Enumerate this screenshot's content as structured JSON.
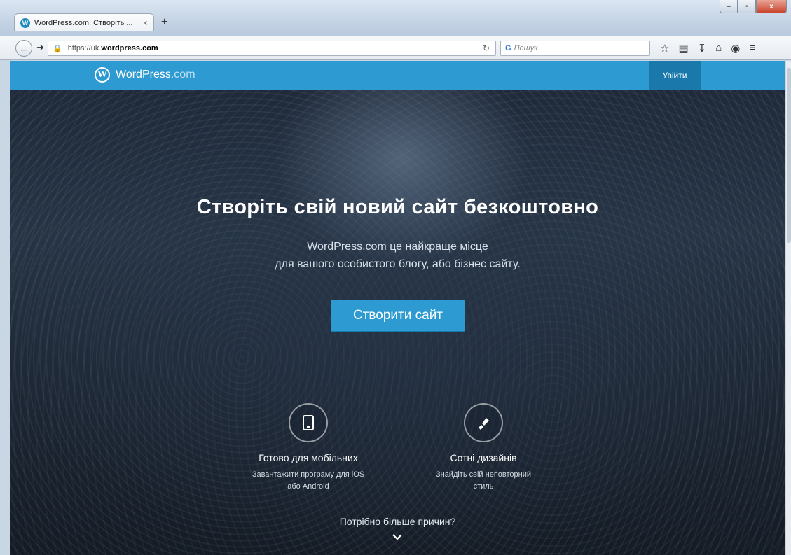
{
  "browser": {
    "tab_title": "WordPress.com: Створіть ...",
    "tab_close": "×",
    "new_tab": "+",
    "url_prefix": "https://uk.",
    "url_domain": "wordpress.com",
    "search_placeholder": "Пошук",
    "window_controls": [
      "–",
      "▫",
      "x"
    ]
  },
  "masterbar": {
    "brand_main": "WordPress",
    "brand_suffix": ".com",
    "login_label": "Увійти",
    "colors": {
      "bar": "#2d9bd1",
      "login": "#1a78ab"
    }
  },
  "hero": {
    "title": "Створіть свій новий сайт безкоштовно",
    "subtitle_line1": "WordPress.com це найкраще місце",
    "subtitle_line2": "для вашого особистого блогу, або бізнес сайту.",
    "cta_label": "Створити сайт"
  },
  "features": [
    {
      "icon": "mobile-phone-icon",
      "title": "Готово для мобільних",
      "desc_line1": "Завантажити програму для iOS",
      "desc_line2": "або Android"
    },
    {
      "icon": "paint-brush-icon",
      "title": "Сотні дизайнів",
      "desc_line1": "Знайдіть свій неповторний",
      "desc_line2": "стиль"
    }
  ],
  "more_reasons": "Потрібно більше причин?"
}
